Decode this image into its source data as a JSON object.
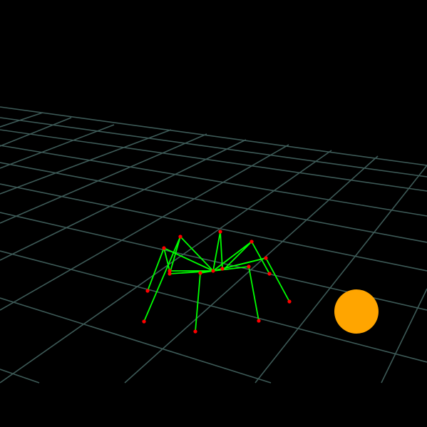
{
  "scene": {
    "background_color": "#000000",
    "grid_color": "#3d5a57",
    "leg_color": "#00ff00",
    "joint_color": "#ff0000",
    "target_color": "#ffa500",
    "objects": [
      "ground-grid",
      "spider-robot",
      "target-ball"
    ],
    "spider": {
      "leg_count": 8
    }
  }
}
